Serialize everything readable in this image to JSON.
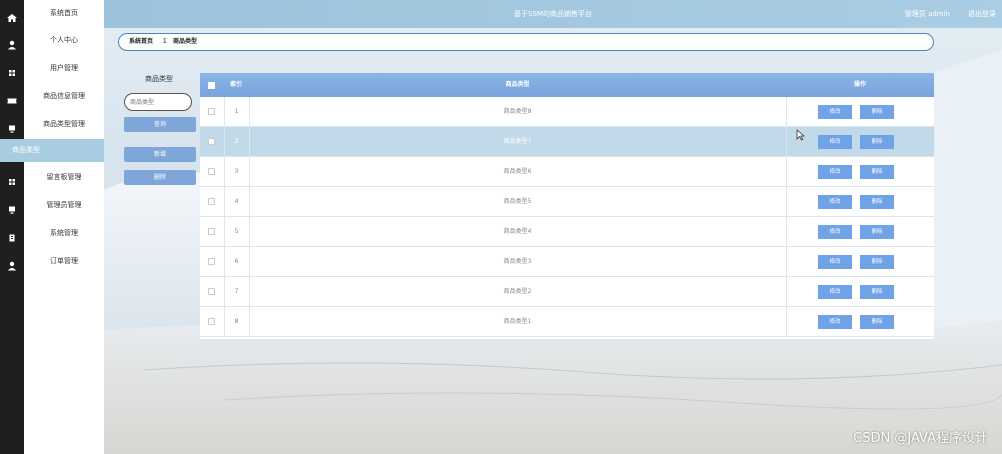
{
  "app": {
    "title": "基于SSM的商品销售平台",
    "user_label": "管理员 admin",
    "logout_label": "退出登录"
  },
  "sidebar": {
    "items": [
      {
        "label": "系统首页",
        "icon": "home-icon"
      },
      {
        "label": "个人中心",
        "icon": "user-icon"
      },
      {
        "label": "用户管理",
        "icon": "grid-icon"
      },
      {
        "label": "商品信息管理",
        "icon": "ticket-icon"
      },
      {
        "label": "商品类型管理",
        "icon": "monitor-icon"
      },
      {
        "label": "留言板管理",
        "icon": "grid-icon"
      },
      {
        "label": "管理员管理",
        "icon": "monitor-icon"
      },
      {
        "label": "系统管理",
        "icon": "clipboard-icon"
      },
      {
        "label": "订单管理",
        "icon": "user-icon"
      }
    ],
    "active_sub": "商品类型"
  },
  "breadcrumb": {
    "home": "系统首页",
    "separator": "Σ",
    "current": "商品类型"
  },
  "search": {
    "label": "商品类型",
    "placeholder": "商品类型",
    "query_button": "查询",
    "add_button": "新增",
    "delete_button": "删除"
  },
  "table": {
    "headers": {
      "index": "索引",
      "type": "商品类型",
      "actions": "操作"
    },
    "rows": [
      {
        "index": "1",
        "type": "商品类型8",
        "highlighted": false
      },
      {
        "index": "2",
        "type": "商品类型7",
        "highlighted": true
      },
      {
        "index": "3",
        "type": "商品类型6",
        "highlighted": false
      },
      {
        "index": "4",
        "type": "商品类型5",
        "highlighted": false
      },
      {
        "index": "5",
        "type": "商品类型4",
        "highlighted": false
      },
      {
        "index": "6",
        "type": "商品类型3",
        "highlighted": false
      },
      {
        "index": "7",
        "type": "商品类型2",
        "highlighted": false
      },
      {
        "index": "8",
        "type": "商品类型1",
        "highlighted": false
      }
    ],
    "edit_label": "修改",
    "delete_label": "删除"
  },
  "watermark": "CSDN @JAVA程序设计",
  "colors": {
    "sidebar_dark": "#1f1f1f",
    "topbar": "#a3c8df",
    "accent_button": "#6fa2e6",
    "header": "#80aae0",
    "highlight_row": "#c2d9ea"
  }
}
